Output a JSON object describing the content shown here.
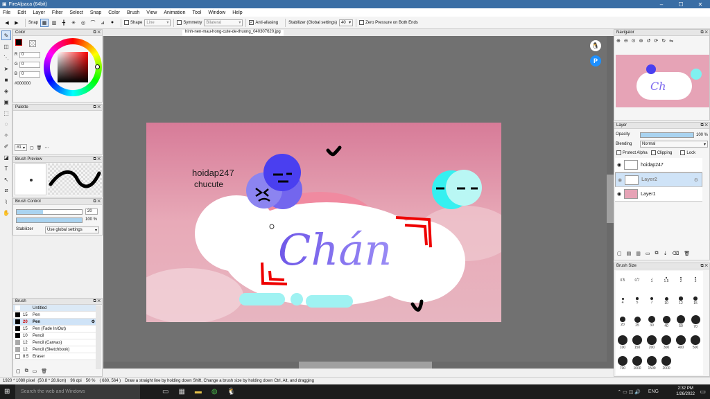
{
  "window": {
    "title": "FireAlpaca (64bit)",
    "minimize": "–",
    "maximize": "☐",
    "close": "✕"
  },
  "menu": [
    "File",
    "Edit",
    "Layer",
    "Filter",
    "Select",
    "Snap",
    "Color",
    "Brush",
    "View",
    "Animation",
    "Tool",
    "Window",
    "Help"
  ],
  "toolbar": {
    "snap": "Snap",
    "shape": "Shape",
    "shape_value": "Line",
    "symmetry": "Symmetry",
    "symmetry_value": "Bilateral",
    "antialias": "Anti-aliasing",
    "stabilizer": "Stabilizer (Global settings)",
    "stabilizer_value": "40",
    "zero_pressure": "Zero Pressure on Both Ends"
  },
  "document_tab": "hinh-nen-mau-hong-cute-de-thuong_040307620.jpg",
  "color_panel": {
    "title": "Color",
    "r_label": "R",
    "r": "0",
    "g_label": "G",
    "g": "0",
    "b_label": "B",
    "b": "0",
    "hex": "#000000"
  },
  "palette_panel": {
    "title": "Palette",
    "selector": "#1"
  },
  "brush_preview": {
    "title": "Brush Preview"
  },
  "brush_control": {
    "title": "Brush Control",
    "size": "20",
    "opacity": "100 %",
    "stabilizer_label": "Stabilizer",
    "stabilizer_value": "Use global settings"
  },
  "brush_panel": {
    "title": "Brush",
    "items": [
      {
        "size": "",
        "name": "Untitled",
        "color": "#ffffff"
      },
      {
        "size": "15",
        "name": "Pen",
        "color": "#222222"
      },
      {
        "size": "20",
        "name": "Pen",
        "color": "#222222"
      },
      {
        "size": "15",
        "name": "Pen (Fade In/Out)",
        "color": "#222222"
      },
      {
        "size": "10",
        "name": "Pencil",
        "color": "#222222"
      },
      {
        "size": "12",
        "name": "Pencil (Canvas)",
        "color": "#aaaaaa"
      },
      {
        "size": "12",
        "name": "Pencil (Sketchbook)",
        "color": "#aaaaaa"
      },
      {
        "size": "8.5",
        "name": "Eraser",
        "color": "#ffffff"
      }
    ]
  },
  "canvas": {
    "text_line1": "hoidap247",
    "text_line2": "chucute",
    "title_word": "Chán",
    "background": "#e8a0b4"
  },
  "navigator": {
    "title": "Navigator"
  },
  "layer_panel": {
    "title": "Layer",
    "opacity_label": "Opacity",
    "opacity_value": "100 %",
    "blending_label": "Blending",
    "blending_value": "Normal",
    "protect_alpha": "Protect Alpha",
    "clipping": "Clipping",
    "lock": "Lock",
    "layers": [
      {
        "name": "hoidap247"
      },
      {
        "name": "Layer2"
      },
      {
        "name": "Layer1"
      }
    ]
  },
  "brush_size": {
    "title": "Brush Size",
    "sizes": [
      "0.5",
      "0.7",
      "1",
      "1.5",
      "2",
      "3",
      "4",
      "5",
      "7",
      "10",
      "12",
      "15",
      "20",
      "25",
      "30",
      "40",
      "50",
      "70",
      "100",
      "150",
      "200",
      "300",
      "400",
      "500",
      "700",
      "1000",
      "1500",
      "2000"
    ]
  },
  "status": {
    "size": "1920 * 1080 pixel",
    "cm": "(50.8 * 28.6cm)",
    "dpi": "96 dpi",
    "zoom": "50 %",
    "coords": "( 680, 564 )",
    "hint": "Draw a straight line by holding down Shift, Change a brush size by holding down Ctrl, Alt, and dragging"
  },
  "taskbar": {
    "search": "Search the web and Windows",
    "lang": "ENG",
    "time": "2:32 PM",
    "date": "1/26/2022"
  }
}
